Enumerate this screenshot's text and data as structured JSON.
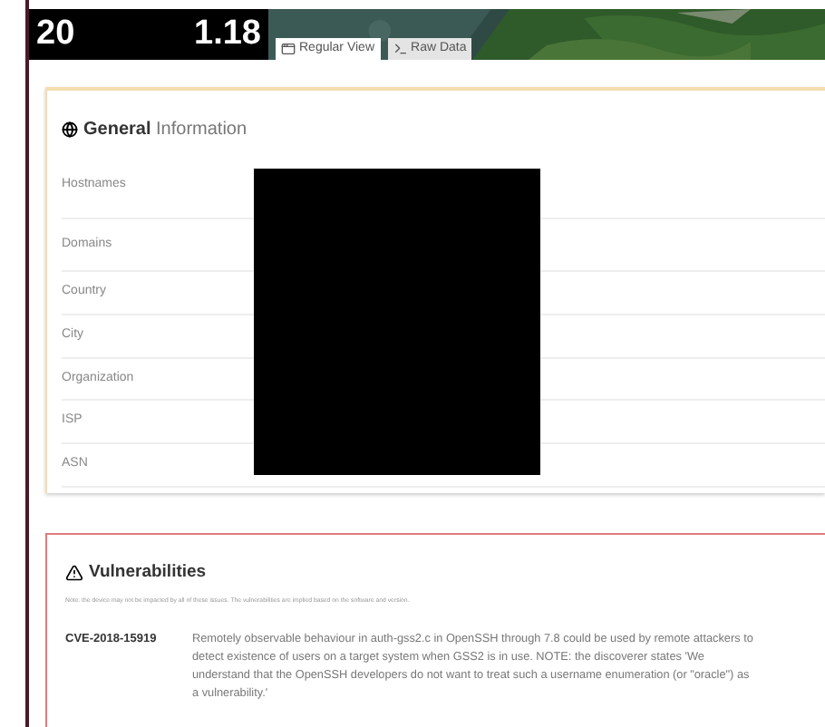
{
  "header": {
    "stat_1": "20",
    "stat_2": "1.18",
    "tabs": [
      {
        "label": "Regular View",
        "kind": "window",
        "selected": true
      },
      {
        "label": "Raw Data",
        "kind": "terminal",
        "selected": false
      }
    ]
  },
  "general": {
    "title_bold": "General",
    "title_rest": "Information",
    "fields": [
      {
        "label": "Hostnames"
      },
      {
        "label": "Domains"
      },
      {
        "label": "Country"
      },
      {
        "label": "City"
      },
      {
        "label": "Organization"
      },
      {
        "label": "ISP"
      },
      {
        "label": "ASN"
      }
    ]
  },
  "vulnerabilities": {
    "title": "Vulnerabilities",
    "note": "Note: the device may not be impacted by all of these issues. The vulnerabilities are implied based on the software and version.",
    "items": [
      {
        "id": "CVE-2018-15919",
        "description": "Remotely observable behaviour in auth-gss2.c in OpenSSH through 7.8 could be used by remote attackers to detect existence of users on a target system when GSS2 is in use. NOTE: the discoverer states 'We understand that the OpenSSH developers do not want to treat such a username enumeration (or \"oracle\") as a vulnerability.'"
      }
    ]
  }
}
